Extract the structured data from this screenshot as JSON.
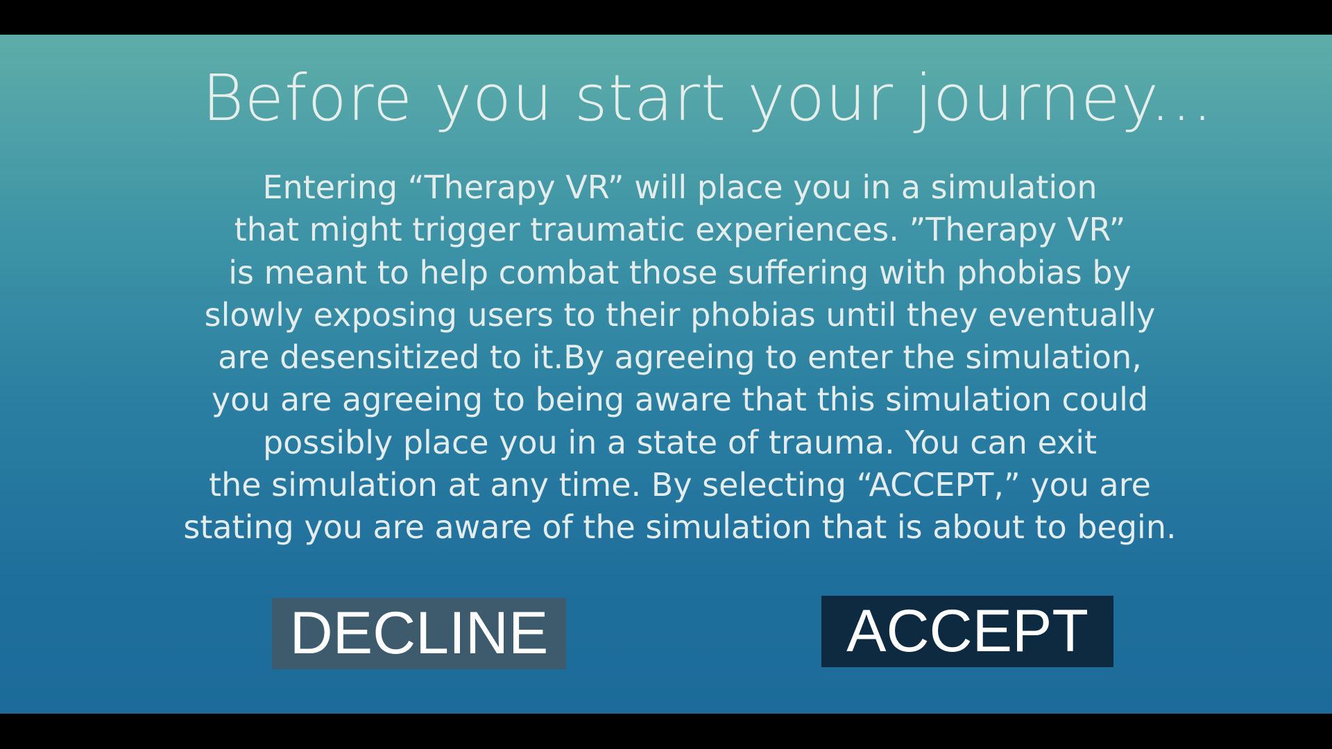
{
  "title": "Before you start your journey...",
  "body_lines": [
    "Entering “Therapy VR” will place you in a simulation",
    "that might trigger traumatic experiences. ”Therapy VR”",
    "is meant to help combat those suffering with phobias by",
    "slowly exposing users to their phobias until they eventually",
    "are desensitized to it.By agreeing to enter the simulation,",
    "you are agreeing to being aware that this simulation could",
    "possibly place you in a state of trauma. You can exit",
    "the simulation at any time. By selecting “ACCEPT,” you are",
    "stating you are aware of the simulation that is about to begin."
  ],
  "buttons": {
    "decline_label": "DECLINE",
    "accept_label": "ACCEPT"
  },
  "colors": {
    "gradient_top": "#5eada9",
    "gradient_bottom": "#1c6b9a",
    "decline_bg": "#3e5b6e",
    "accept_bg": "#0d2a40",
    "text": "#e4ecec"
  }
}
